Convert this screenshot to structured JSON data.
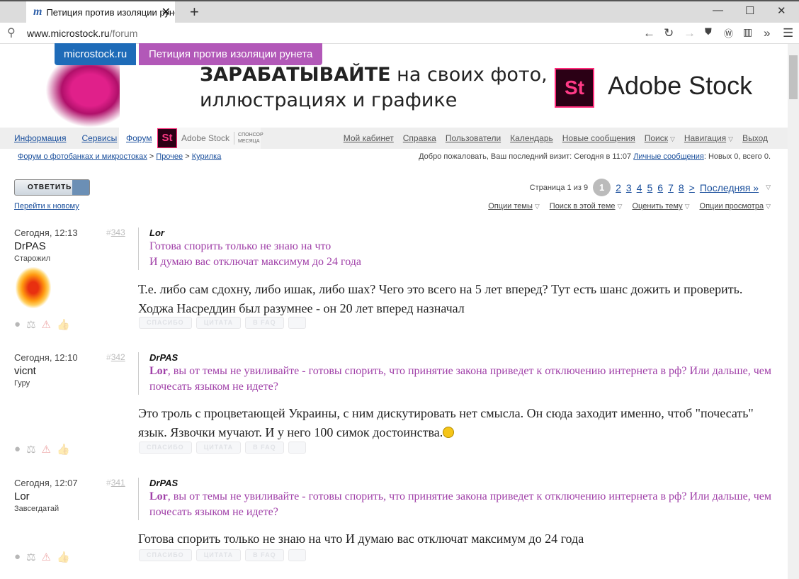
{
  "browser": {
    "tab_title": "Петиция против изоляции рунета",
    "url_domain": "www.microstock.ru",
    "url_path": "/forum"
  },
  "banner": {
    "site": "microstock.ru",
    "petition": "Петиция против изоляции рунета",
    "slogan_bold": "ЗАРАБАТЫВАЙТЕ",
    "slogan_rest": " на своих фото,",
    "slogan_line2": "иллюстрациях и графике",
    "brand_logo": "St",
    "brand_name": "Adobe Stock"
  },
  "nav": {
    "left": [
      "Информация",
      "Сервисы",
      "Форум"
    ],
    "sponsor_logo": "St",
    "sponsor_name": "Adobe Stock",
    "sponsor_label": "СПОНСОР МЕСЯЦА",
    "right": [
      "Мой кабинет",
      "Справка",
      "Пользователи",
      "Календарь",
      "Новые сообщения",
      "Поиск",
      "Навигация",
      "Выход"
    ]
  },
  "breadcrumb": [
    "Форум о фотобанках и микростоках",
    "Прочее",
    "Курилка"
  ],
  "welcome": {
    "text": "Добро пожаловать, Ваш последний визит: Сегодня в 11:07 ",
    "pm_link": "Личные сообщения",
    "pm_counts": ": Новых 0, всего 0."
  },
  "actions": {
    "reply": "ОТВЕТИТЬ",
    "go_new": "Перейти к новому"
  },
  "pager": {
    "label": "Страница 1 из 9",
    "current": "1",
    "pages": [
      "2",
      "3",
      "4",
      "5",
      "6",
      "7",
      "8"
    ],
    "next": ">",
    "last": "Последняя »"
  },
  "options": [
    "Опции темы",
    "Поиск в этой теме",
    "Оценить тему",
    "Опции просмотра"
  ],
  "post_buttons": [
    "СПАСИБО",
    "ЦИТАТА",
    "В FAQ"
  ],
  "posts": [
    {
      "date": "Сегодня, 12:13",
      "num": "343",
      "user": "DrPAS",
      "rank": "Старожил",
      "quote_author": "Lor",
      "quote_lines": [
        "Готова спорить только не знаю на что",
        "И думаю вас отключат максимум до 24 года"
      ],
      "text": "Т.е. либо сам сдохну, либо ишак, либо шах? Чего это всего на 5 лет вперед? Тут есть шанс дожить и проверить. Ходжа Насреддин был разумнее - он 20 лет вперед назначал"
    },
    {
      "date": "Сегодня, 12:10",
      "num": "342",
      "user": "vicnt",
      "rank": "Гуру",
      "quote_author": "DrPAS",
      "quote_bold": "Lor",
      "quote_rest": ", вы от темы не увиливайте - готовы спорить, что принятие закона приведет к отключению интернета в рф? Или дальше, чем почесать языком не идете?",
      "text": "Это троль с процветающей Украины, с ним дискутировать нет смысла. Он сюда заходит именно, чтоб \"почесать\" язык. Язвочки мучают. И у него 100 симок достоинства."
    },
    {
      "date": "Сегодня, 12:07",
      "num": "341",
      "user": "Lor",
      "rank": "Завсегдатай",
      "quote_author": "DrPAS",
      "quote_bold": "Lor",
      "quote_rest": ", вы от темы не увиливайте - готовы спорить, что принятие закона приведет к отключению интернета в рф? Или дальше, чем почесать языком не идете?",
      "text": "Готова спорить только не знаю на что И думаю вас отключат максимум до 24 года"
    }
  ]
}
